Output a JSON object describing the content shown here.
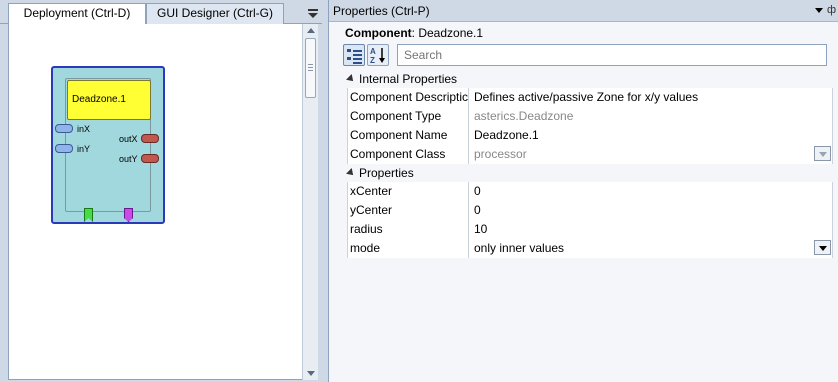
{
  "left": {
    "tabs": [
      {
        "label": "Deployment (Ctrl-D)",
        "active": true
      },
      {
        "label": "GUI Designer (Ctrl-G)",
        "active": false
      }
    ],
    "component": {
      "title": "Deadzone.1",
      "inputs": [
        "inX",
        "inY"
      ],
      "outputs": [
        "outX",
        "outY"
      ]
    }
  },
  "right": {
    "header_title": "Properties (Ctrl-P)",
    "component_label": "Component",
    "component_value": "Deadzone.1",
    "search_placeholder": "Search",
    "categories": [
      {
        "label": "Internal Properties",
        "rows": [
          {
            "name": "Component Descriptic",
            "value": "Defines active/passive Zone for x/y values",
            "readonly": false,
            "combo": false
          },
          {
            "name": "Component Type",
            "value": "asterics.Deadzone",
            "readonly": true,
            "combo": false
          },
          {
            "name": "Component Name",
            "value": "Deadzone.1",
            "readonly": false,
            "combo": false
          },
          {
            "name": "Component Class",
            "value": "processor",
            "readonly": true,
            "combo": true
          }
        ]
      },
      {
        "label": "Properties",
        "rows": [
          {
            "name": "xCenter",
            "value": "0",
            "readonly": false,
            "combo": false
          },
          {
            "name": "yCenter",
            "value": "0",
            "readonly": false,
            "combo": false
          },
          {
            "name": "radius",
            "value": "10",
            "readonly": false,
            "combo": false
          },
          {
            "name": "mode",
            "value": "only inner values",
            "readonly": false,
            "combo": true
          }
        ]
      }
    ]
  },
  "colors": {
    "component_body": "#a0d8de",
    "component_border": "#2a3ab8",
    "component_title": "#ffff33",
    "input_port": "#8fb4e8",
    "output_port": "#c0584f",
    "event_trigger": "#44dd44",
    "event_listener": "#c84ae8"
  }
}
